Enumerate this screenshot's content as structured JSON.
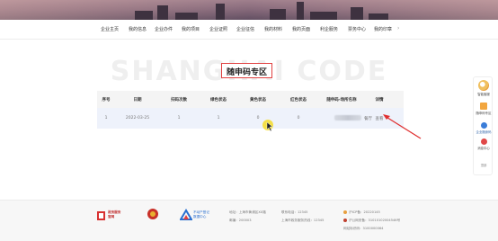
{
  "nav": {
    "items": [
      "企业主页",
      "我的信息",
      "企业办件",
      "我的项目",
      "企业证照",
      "企业征信",
      "我的材料",
      "我的页面",
      "利企服务",
      "票务中心",
      "我的印章"
    ]
  },
  "section": {
    "watermark": "SHANGHAI CODE",
    "title": "随申码专区"
  },
  "table": {
    "headers": [
      "序号",
      "日期",
      "扫码次数",
      "绿色状态",
      "黄色状态",
      "红色状态",
      "随申码-场所名称",
      "详情"
    ],
    "rows": [
      {
        "index": "1",
        "date": "2022-03-25",
        "scans": "1",
        "green": "1",
        "yellow": "0",
        "red": "0",
        "place_suffix": "餐厅",
        "detail": "查看"
      }
    ]
  },
  "sidebar": {
    "items": [
      {
        "label": "智能客服",
        "icon": "robot-icon"
      },
      {
        "label": "随申码专区",
        "icon": "qrcode-icon"
      },
      {
        "label": "企业随身码",
        "icon": "enterprise-icon"
      },
      {
        "label": "消息中心",
        "icon": "message-icon"
      },
      {
        "label": "顶部",
        "icon": "top-icon"
      }
    ]
  },
  "footer": {
    "logo1": "政务服务\n官网",
    "logo3": "不动产登记\n数据中心",
    "address": "地址：上海市黄浦区XX路",
    "zipcode": "邮编：200003",
    "hotline": "联系电话：12345",
    "hotline2": "上海市政务服务热线：12345",
    "icp1": "沪ICP备：20220145",
    "icp2": "沪公网安备：31010102004546号",
    "site_id": "网站标识码：3100000064"
  },
  "colors": {
    "accent": "#e04040",
    "link": "#e8a040",
    "row_bg": "#eef2fb"
  }
}
